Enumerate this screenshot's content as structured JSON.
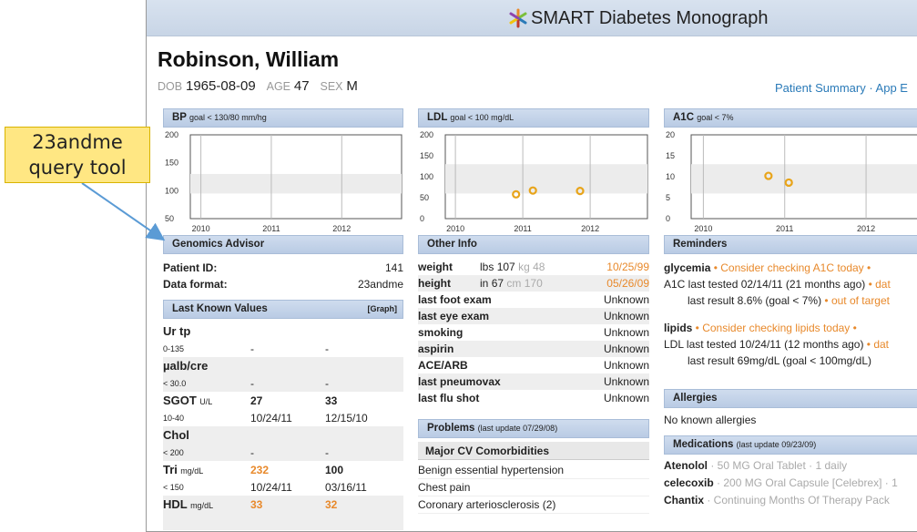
{
  "callout": {
    "line1": "23andme",
    "line2": "query tool"
  },
  "header": {
    "title": "SMART Diabetes Monograph"
  },
  "patient": {
    "name": "Robinson, William",
    "dob_label": "DOB",
    "dob": "1965-08-09",
    "age_label": "AGE",
    "age": "47",
    "sex_label": "SEX",
    "sex": "M",
    "links": "Patient Summary · App E"
  },
  "bp": {
    "title": "BP",
    "goal": "goal < 130/80 mm/hg",
    "chart_data": {
      "type": "line",
      "title": "BP goal < 130/80 mm/hg",
      "ylim": [
        50,
        200
      ],
      "yticks": [
        "200",
        "150",
        "100",
        "50"
      ],
      "xticks": [
        "2010",
        "2011",
        "2012"
      ],
      "series": []
    }
  },
  "ldl": {
    "title": "LDL",
    "goal": "goal < 100 mg/dL",
    "chart_data": {
      "type": "scatter",
      "title": "LDL goal < 100 mg/dL",
      "ylim": [
        0,
        200
      ],
      "yticks": [
        "200",
        "150",
        "100",
        "50",
        "0"
      ],
      "xticks": [
        "2010",
        "2011",
        "2012"
      ],
      "points": [
        {
          "x": 2010.9,
          "y": 58
        },
        {
          "x": 2011.15,
          "y": 67
        },
        {
          "x": 2011.85,
          "y": 66
        }
      ]
    }
  },
  "a1c": {
    "title": "A1C",
    "goal": "goal < 7%",
    "chart_data": {
      "type": "scatter",
      "title": "A1C goal < 7%",
      "ylim": [
        0,
        20
      ],
      "yticks": [
        "20",
        "15",
        "10",
        "5",
        "0"
      ],
      "xticks": [
        "2010",
        "2011",
        "2012"
      ],
      "points": [
        {
          "x": 2010.8,
          "y": 10.2
        },
        {
          "x": 2011.05,
          "y": 8.6
        }
      ]
    }
  },
  "genomics": {
    "title": "Genomics Advisor",
    "patient_id_label": "Patient ID:",
    "patient_id": "141",
    "format_label": "Data format:",
    "format": "23andme"
  },
  "lkv": {
    "title": "Last Known Values",
    "graph_link": "[Graph]",
    "items": [
      {
        "name": "Ur tp",
        "unit": "",
        "v1": "",
        "v2": "",
        "range": "0-135",
        "d1": "-",
        "d2": "-"
      },
      {
        "name": "µalb/cre",
        "unit": "",
        "v1": "",
        "v2": "",
        "range": "< 30.0",
        "d1": "-",
        "d2": "-"
      },
      {
        "name": "SGOT",
        "unit": "U/L",
        "v1": "27",
        "v2": "33",
        "range": "10-40",
        "d1": "10/24/11",
        "d2": "12/15/10"
      },
      {
        "name": "Chol",
        "unit": "",
        "v1": "",
        "v2": "",
        "range": "< 200",
        "d1": "-",
        "d2": "-"
      },
      {
        "name": "Tri",
        "unit": "mg/dL",
        "v1": "232",
        "v2": "100",
        "range": "< 150",
        "d1": "10/24/11",
        "d2": "03/16/11"
      },
      {
        "name": "HDL",
        "unit": "mg/dL",
        "v1": "33",
        "v2": "32",
        "range": "",
        "d1": "",
        "d2": ""
      }
    ]
  },
  "other": {
    "title": "Other Info",
    "weight": {
      "label": "weight",
      "unit1": "lbs",
      "v1": "107",
      "unit2": "kg",
      "v2": "48",
      "date": "10/25/99"
    },
    "height": {
      "label": "height",
      "unit1": "in",
      "v1": "67",
      "unit2": "cm",
      "v2": "170",
      "date": "05/26/09"
    },
    "items": [
      {
        "label": "last foot exam",
        "value": "Unknown"
      },
      {
        "label": "last eye exam",
        "value": "Unknown"
      },
      {
        "label": "smoking",
        "value": "Unknown"
      },
      {
        "label": "aspirin",
        "value": "Unknown"
      },
      {
        "label": "ACE/ARB",
        "value": "Unknown"
      },
      {
        "label": "last pneumovax",
        "value": "Unknown"
      },
      {
        "label": "last flu shot",
        "value": "Unknown"
      }
    ]
  },
  "problems": {
    "title": "Problems",
    "updated": "(last update 07/29/08)",
    "sub": "Major CV Comorbidities",
    "items": [
      "Benign essential hypertension",
      "Chest pain",
      "Coronary arteriosclerosis (2)"
    ]
  },
  "reminders": {
    "title": "Reminders",
    "glycemia": {
      "name": "glycemia",
      "advice": " • Consider checking A1C today •",
      "l2": "A1C last tested 02/14/11 (21 months ago)",
      "l2o": " • dat",
      "l3": "last result 8.6% (goal < 7%)",
      "l3o": " • out of target"
    },
    "lipids": {
      "name": "lipids",
      "advice": " • Consider checking lipids today •",
      "l2": "LDL last tested 10/24/11 (12 months ago)",
      "l2o": " • dat",
      "l3": "last result 69mg/dL (goal < 100mg/dL)"
    }
  },
  "allergies": {
    "title": "Allergies",
    "text": "No known allergies"
  },
  "medications": {
    "title": "Medications",
    "updated": "(last update 09/23/09)",
    "items": [
      {
        "name": "Atenolol",
        "detail": " · 50 MG Oral Tablet · 1 daily"
      },
      {
        "name": "celecoxib",
        "detail": " · 200 MG Oral Capsule [Celebrex] · 1"
      },
      {
        "name": "Chantix",
        "detail": " · Continuing Months Of Therapy Pack"
      }
    ]
  },
  "colors": {
    "accent": "#2a7ab8",
    "highlight": "#e8892b",
    "header_bg": "#c8d5e6",
    "callout_bg": "#ffe783"
  }
}
